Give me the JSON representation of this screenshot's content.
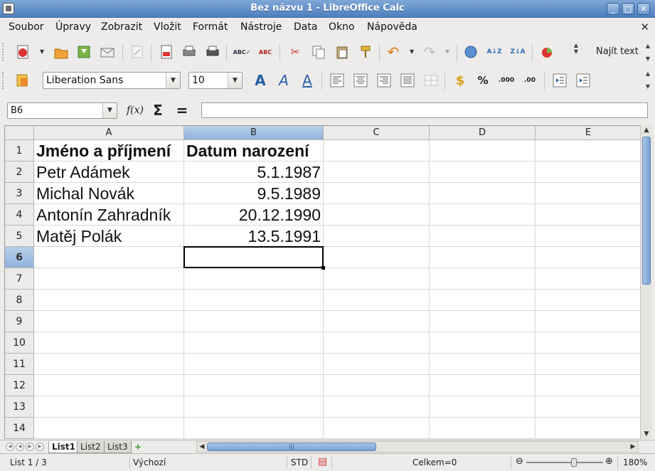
{
  "window": {
    "title": "Bez názvu 1 - LibreOffice Calc"
  },
  "menu": {
    "items": [
      "Soubor",
      "Úpravy",
      "Zobrazit",
      "Vložit",
      "Formát",
      "Nástroje",
      "Data",
      "Okno",
      "Nápověda"
    ],
    "close_doc": "✕"
  },
  "toolbar": {
    "search_label": "Najít text"
  },
  "format": {
    "font_name": "Liberation Sans",
    "font_size": "10"
  },
  "formula": {
    "name_box": "B6",
    "content": ""
  },
  "grid": {
    "columns": [
      "A",
      "B",
      "C",
      "D",
      "E"
    ],
    "active_column": "B",
    "rows": [
      "1",
      "2",
      "3",
      "4",
      "5",
      "6",
      "7",
      "8",
      "9",
      "10",
      "11",
      "12",
      "13",
      "14"
    ],
    "active_row": "6",
    "cells": {
      "A1": "Jméno a příjmení",
      "B1": "Datum narození",
      "A2": "Petr Adámek",
      "B2": "5.1.1987",
      "A3": "Michal Novák",
      "B3": "9.5.1989",
      "A4": "Antonín Zahradník",
      "B4": "20.12.1990",
      "A5": "Matěj Polák",
      "B5": "13.5.1991"
    }
  },
  "sheets": {
    "tabs": [
      "List1",
      "List2",
      "List3"
    ],
    "active": "List1"
  },
  "status": {
    "sheet_info": "List 1 / 3",
    "style": "Výchozí",
    "mode": "STD",
    "sum": "Celkem=0",
    "zoom": "180%"
  }
}
